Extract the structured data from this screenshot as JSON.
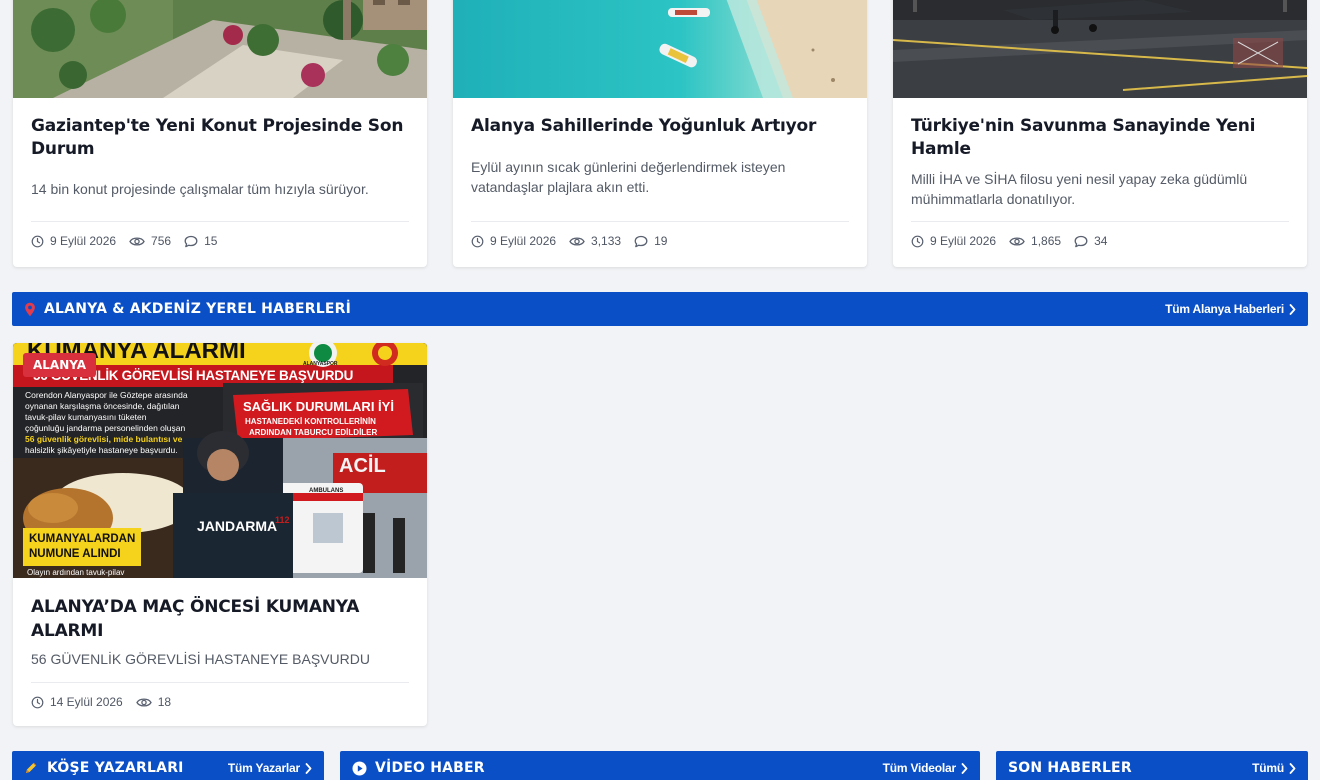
{
  "top_cards": [
    {
      "title": "Gaziantep'te Yeni Konut Projesinde Son Durum",
      "description": "14 bin konut projesinde çalışmalar tüm hızıyla sürüyor.",
      "date": "9 Eylül 2026",
      "views": "756",
      "comments": "15"
    },
    {
      "title": "Alanya Sahillerinde Yoğunluk Artıyor",
      "description": "Eylül ayının sıcak günlerini değerlendirmek isteyen vatandaşlar plajlara akın etti.",
      "date": "9 Eylül 2026",
      "views": "3,133",
      "comments": "19"
    },
    {
      "title": "Türkiye'nin Savunma Sanayinde Yeni Hamle",
      "description": "Milli İHA ve SİHA filosu yeni nesil yapay zeka güdümlü mühimmatlarla donatılıyor.",
      "date": "9 Eylül 2026",
      "views": "1,865",
      "comments": "34"
    }
  ],
  "local_section": {
    "title": "ALANYA & AKDENİZ YEREL HABERLERİ",
    "link": "Tüm Alanya Haberleri"
  },
  "local_card": {
    "badge": "ALANYA",
    "title": "ALANYA’DA MAÇ ÖNCESİ KUMANYA ALARMI",
    "description": "56 GÜVENLİK GÖREVLİSİ HASTANEYE BAŞVURDU",
    "date": "14 Eylül 2026",
    "views": "18",
    "poster": {
      "headline_top": "KUMANYA ALARMI",
      "headline_sub": "56 GÜVENLİK GÖREVLİSİ HASTANEYE BAŞVURDU",
      "body_1": "Corendon Alanyaspor ile Göztepe arasında",
      "body_2": "oynanan karşılaşma öncesinde, dağıtılan",
      "body_3": "tavuk-pilav kumanyasını tüketen",
      "body_4": "çoğunluğu jandarma personelinden oluşan",
      "body_5": "56 güvenlik görevlisi, mide bulantısı ve",
      "body_6": "halsizlik şikâyetiyle hastaneye başvurdu.",
      "callout_1": "SAĞLIK DURUMLARI İYİ",
      "callout_2": "HASTANEDEKİ KONTROLLERİNİN",
      "callout_3": "ARDINDAN TABURCU EDİLDİLER",
      "acil": "ACİL",
      "jandarma": "JANDARMA",
      "ambulans": "AMBULANS",
      "plate": "112",
      "sample_1": "KUMANYALARDAN",
      "sample_2": "NUMUNE ALINDI",
      "footer": "Olayın ardından tavuk-pilav",
      "club": "ALANYASPOR"
    }
  },
  "bottom_sections": [
    {
      "title": "KÖŞE YAZARLARI",
      "link": "Tüm Yazarlar"
    },
    {
      "title": "VİDEO HABER",
      "link": "Tüm Videolar"
    },
    {
      "title": "SON HABERLER",
      "link": "Tümü"
    }
  ],
  "colors": {
    "brand_blue": "#0a4fc6",
    "badge_red": "#d8303c",
    "pin_red": "#e23b4b",
    "pen_yellow": "#f4c430"
  },
  "icons": [
    "clock-icon",
    "eye-icon",
    "comment-icon",
    "location-pin-icon",
    "chevron-right-icon",
    "pen-icon",
    "play-circle-icon"
  ]
}
